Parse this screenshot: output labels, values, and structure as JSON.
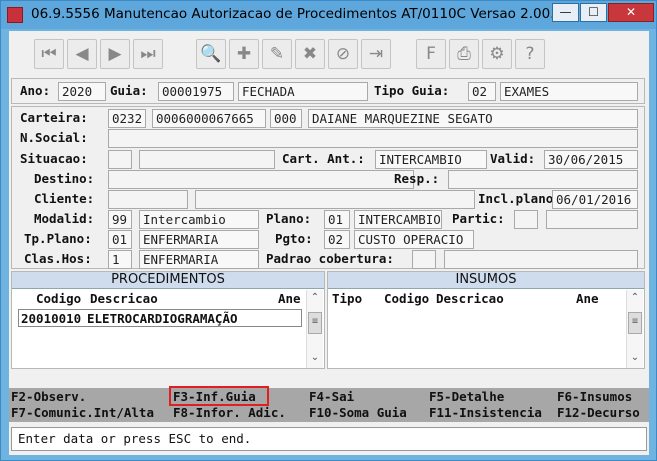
{
  "window": {
    "title": "06.9.5556 Manutencao Autorizacao de Procedimentos AT/0110C Versao 2.00...",
    "min": "—",
    "max": "☐",
    "close": "✕"
  },
  "toolbar": {
    "icons": [
      "first-record-icon",
      "prev-record-icon",
      "next-record-icon",
      "last-record-icon",
      "search-icon",
      "add-icon",
      "edit-icon",
      "delete-icon",
      "cancel-icon",
      "exit-icon",
      "form-icon",
      "print-icon",
      "options-icon",
      "help-icon"
    ]
  },
  "header": {
    "ano_label": "Ano:",
    "ano": "2020",
    "guia_label": "Guia:",
    "guia": "00001975",
    "status": "FECHADA",
    "tipo_guia_label": "Tipo Guia:",
    "tipo_guia_code": "02",
    "tipo_guia": "EXAMES"
  },
  "beneficiario": {
    "carteira_label": "Carteira:",
    "carteira_1": "0232",
    "carteira_2": "0006000067665",
    "carteira_3": "000",
    "nome": "DAIANE MARQUEZINE SEGATO",
    "nsocial_label": "N.Social:",
    "situacao_label": "Situacao:",
    "cart_ant_label": "Cart. Ant.:",
    "cart_ant": "INTERCAMBIO",
    "valid_label": "Valid:",
    "valid": "30/06/2015",
    "destino_label": "Destino:",
    "resp_label": "Resp.:",
    "cliente_label": "Cliente:",
    "incl_plano_label": "Incl.plano:",
    "incl_plano": "06/01/2016",
    "modalid_label": "Modalid:",
    "modalid_code": "99",
    "modalid": "Intercambio",
    "plano_label": "Plano:",
    "plano_code": "01",
    "plano": "INTERCAMBIO",
    "partic_label": "Partic:",
    "tp_plano_label": "Tp.Plano:",
    "tp_plano_code": "01",
    "tp_plano": "ENFERMARIA",
    "pgto_label": "Pgto:",
    "pgto_code": "02",
    "pgto": "CUSTO OPERACIO",
    "clas_hos_label": "Clas.Hos:",
    "clas_hos_code": "1",
    "clas_hos": "ENFERMARIA",
    "padrao_label": "Padrao cobertura:"
  },
  "procedimentos": {
    "title": "PROCEDIMENTOS",
    "columns": [
      "Codigo",
      "Descricao",
      "Ane"
    ],
    "rows": [
      {
        "codigo": "20010010",
        "descricao": "ELETROCARDIOGRAMAÇÃO"
      }
    ]
  },
  "insumos": {
    "title": "INSUMOS",
    "columns": [
      "Tipo",
      "Codigo",
      "Descricao",
      "Ane"
    ]
  },
  "function_keys": {
    "f2": "F2-Observ.",
    "f3": "F3-Inf.Guia",
    "f4": "F4-Sai",
    "f5": "F5-Detalhe",
    "f6": "F6-Insumos",
    "f7": "F7-Comunic.Int/Alta",
    "f8": "F8-Infor. Adic.",
    "f10": "F10-Soma Guia",
    "f11": "F11-Insistencia",
    "f12": "F12-Decurso"
  },
  "status": {
    "message": "Enter data or press ESC to end."
  },
  "colors": {
    "titlebar": "#5da7dc",
    "highlight": "#e02020"
  }
}
